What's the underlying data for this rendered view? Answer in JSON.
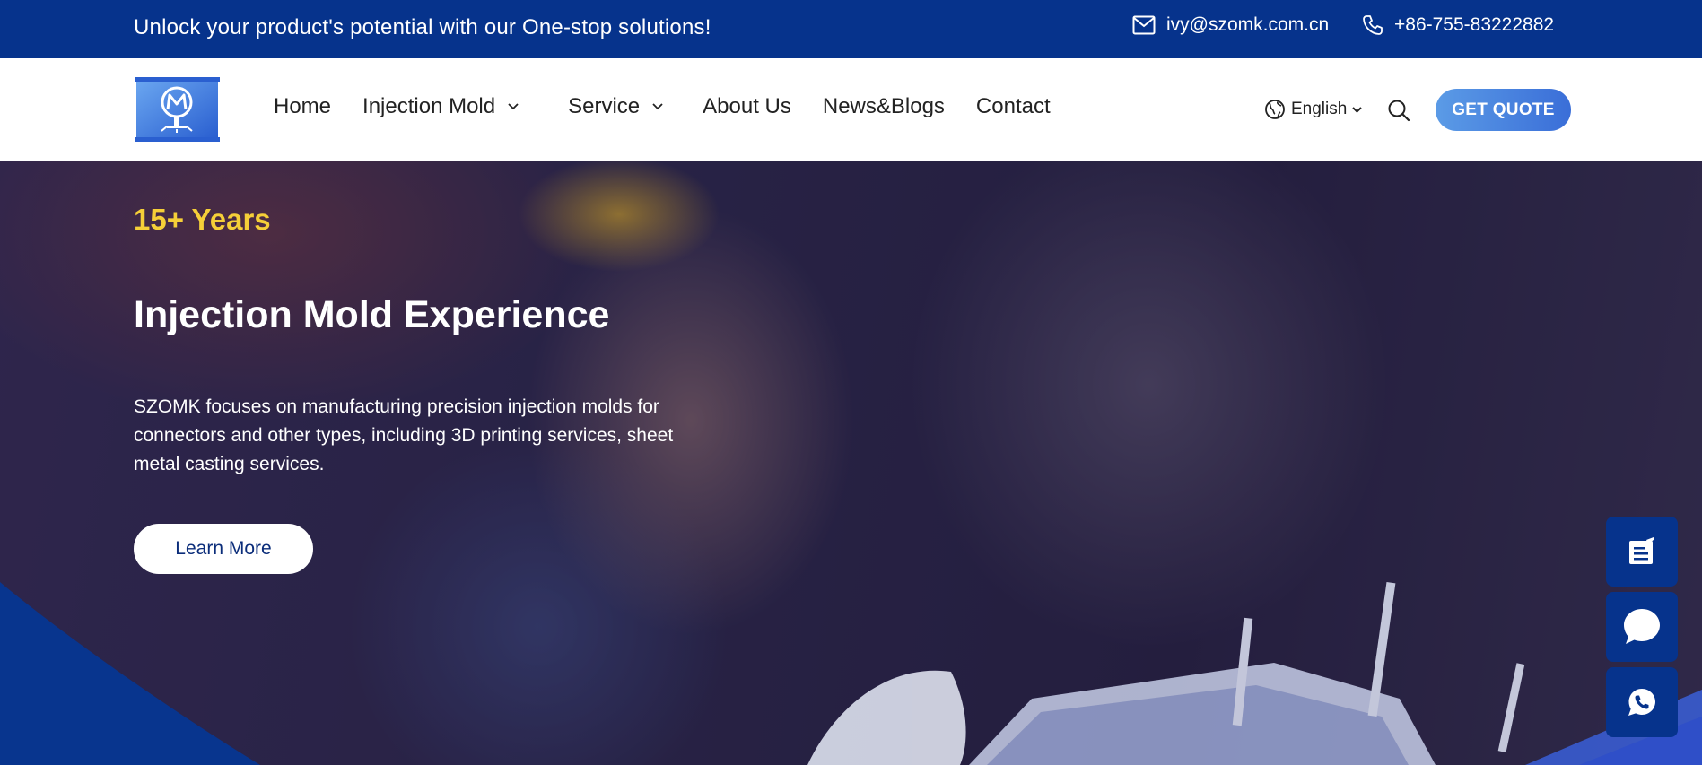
{
  "topbar": {
    "slogan": "Unlock your product's potential with our One-stop solutions!",
    "email": "ivy@szomk.com.cn",
    "phone": "+86-755-83222882",
    "email_icon": "mail-icon",
    "phone_icon": "phone-icon"
  },
  "header": {
    "logo": "szomk-logo",
    "nav": {
      "home": "Home",
      "injection_mold": "Injection Mold",
      "service": "Service",
      "about": "About Us",
      "news": "News&Blogs",
      "contact": "Contact"
    },
    "language": "English",
    "quote_button": "GET QUOTE"
  },
  "hero": {
    "years": "15+ Years",
    "title": "Injection Mold Experience",
    "description": "SZOMK focuses on manufacturing precision injection molds for connectors and other types, including 3D printing services, sheet metal  casting services.",
    "cta": "Learn More"
  },
  "float_buttons": [
    "form-icon",
    "chat-icon",
    "whatsapp-icon"
  ],
  "colors": {
    "brand_navy": "#06338c",
    "accent_yellow": "#f5cf38",
    "quote_gradient_start": "#5b9be6",
    "quote_gradient_end": "#3a6ed8"
  }
}
